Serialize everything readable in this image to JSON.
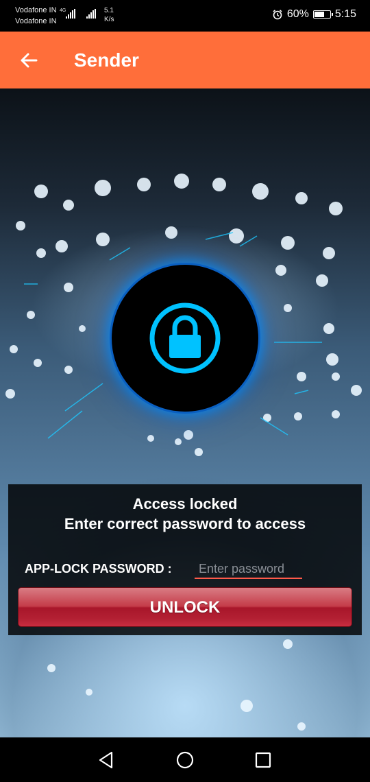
{
  "status_bar": {
    "carrier_1": "Vodafone IN",
    "carrier_2": "Vodafone IN",
    "network_type": "4G",
    "speed_value": "5.1",
    "speed_unit": "K/s",
    "battery": "60%",
    "battery_level": 0.6,
    "time": "5:15",
    "icons": [
      "signal-icon",
      "alarm-icon",
      "battery-icon"
    ]
  },
  "app_bar": {
    "title": "Sender",
    "back_icon": "arrow-left-icon",
    "color": "#ff6e3a"
  },
  "lock": {
    "icon": "padlock-icon",
    "glow_color": "#00c2ff"
  },
  "panel": {
    "title": "Access locked",
    "subtitle": "Enter correct password to access",
    "password_label": "APP-LOCK PASSWORD :",
    "password_placeholder": "Enter password",
    "password_value": "",
    "unlock_label": "UNLOCK",
    "unlock_color": "#c43b48"
  },
  "nav_bar": {
    "back": "triangle-back-icon",
    "home": "circle-home-icon",
    "recents": "square-recents-icon"
  }
}
